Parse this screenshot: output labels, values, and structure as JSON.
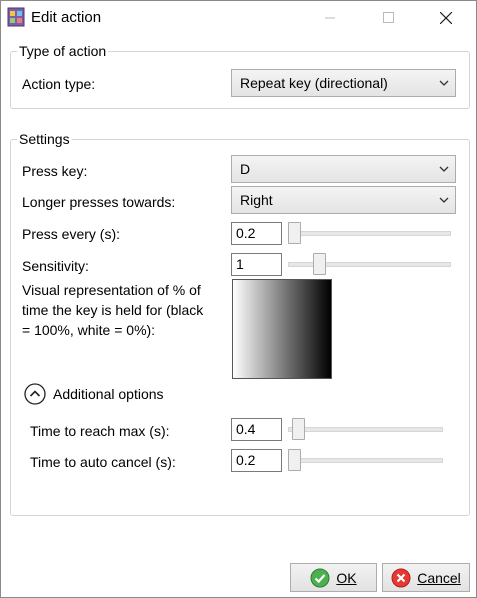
{
  "window": {
    "title": "Edit action"
  },
  "type_group": {
    "legend": "Type of action",
    "action_type_label": "Action type:",
    "action_type_value": "Repeat key (directional)"
  },
  "settings": {
    "legend": "Settings",
    "press_key_label": "Press key:",
    "press_key_value": "D",
    "longer_label": "Longer presses towards:",
    "longer_value": "Right",
    "press_every_label": "Press every (s):",
    "press_every_value": "0.2",
    "sensitivity_label": "Sensitivity:",
    "sensitivity_value": "1",
    "visual_label_1": "Visual representation of % of",
    "visual_label_2": "time the key is held for (black",
    "visual_label_3": "= 100%, white = 0%):",
    "additional_label": "Additional options",
    "time_max_label": "Time to reach max (s):",
    "time_max_value": "0.4",
    "auto_cancel_label": "Time to auto cancel (s):",
    "auto_cancel_value": "0.2"
  },
  "buttons": {
    "ok_label": "OK",
    "cancel_label": "Cancel"
  },
  "icons": {
    "app": "app-icon",
    "chevron": "chevron-down-icon",
    "expander": "chevron-up-circle-icon",
    "ok": "check-icon",
    "cancel": "x-circle-icon"
  },
  "colors": {
    "ok_icon": "#4caf50",
    "cancel_icon": "#e53935",
    "group_border": "#d5d5d5"
  }
}
